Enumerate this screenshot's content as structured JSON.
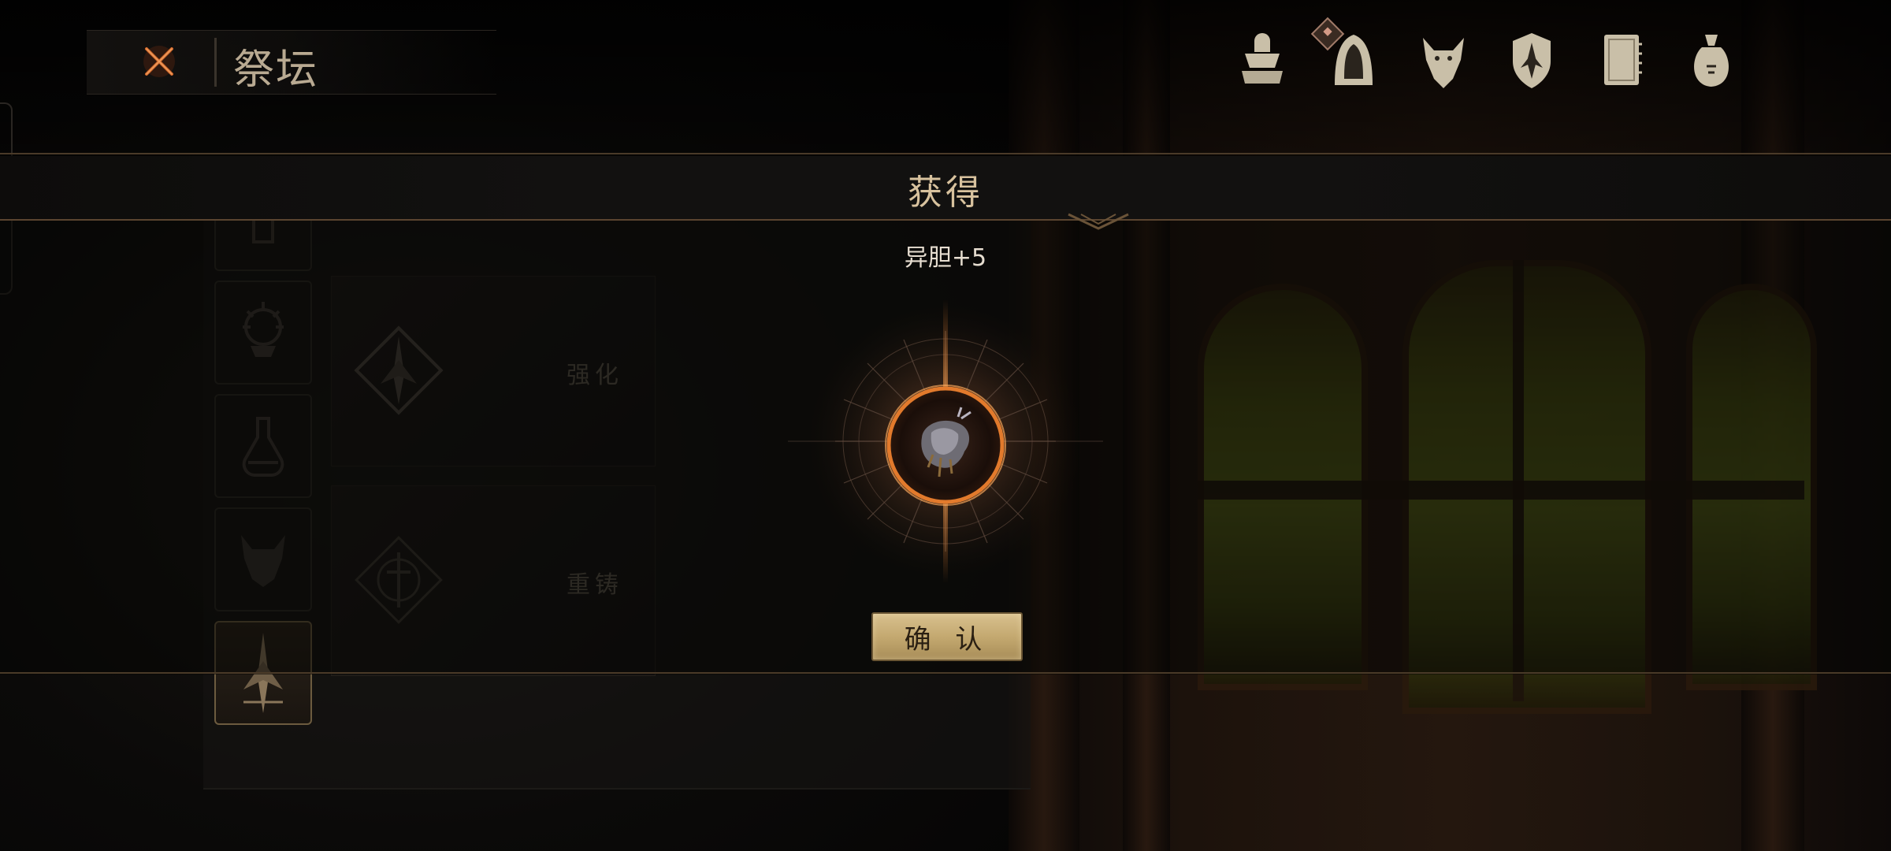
{
  "header": {
    "title": "祭坛",
    "close_icon": "crossed-swords-close-icon"
  },
  "top_nav": {
    "icons": [
      "shrine-icon",
      "hooded-figure-icon",
      "beast-head-icon",
      "shield-emblem-icon",
      "journal-book-icon",
      "coin-bag-icon"
    ],
    "notification_on": "hooded-figure-icon"
  },
  "altar": {
    "side_tabs": [
      "upper-tab-icon",
      "brazier-icon",
      "potion-flask-icon",
      "demon-head-icon",
      "spire-emblem-icon"
    ],
    "active_tab": "spire-emblem-icon",
    "options": [
      {
        "label": "强化"
      },
      {
        "label": "重铸"
      }
    ]
  },
  "reward_modal": {
    "title": "获得",
    "reward_text": "异胆+5",
    "item_icon": "strange-gall-icon",
    "confirm_label": "确 认"
  },
  "colors": {
    "accent_gold": "#c4a970",
    "title_text": "#d8c29e",
    "glow_orange": "#e27a2c",
    "window_green": "#59661a"
  }
}
